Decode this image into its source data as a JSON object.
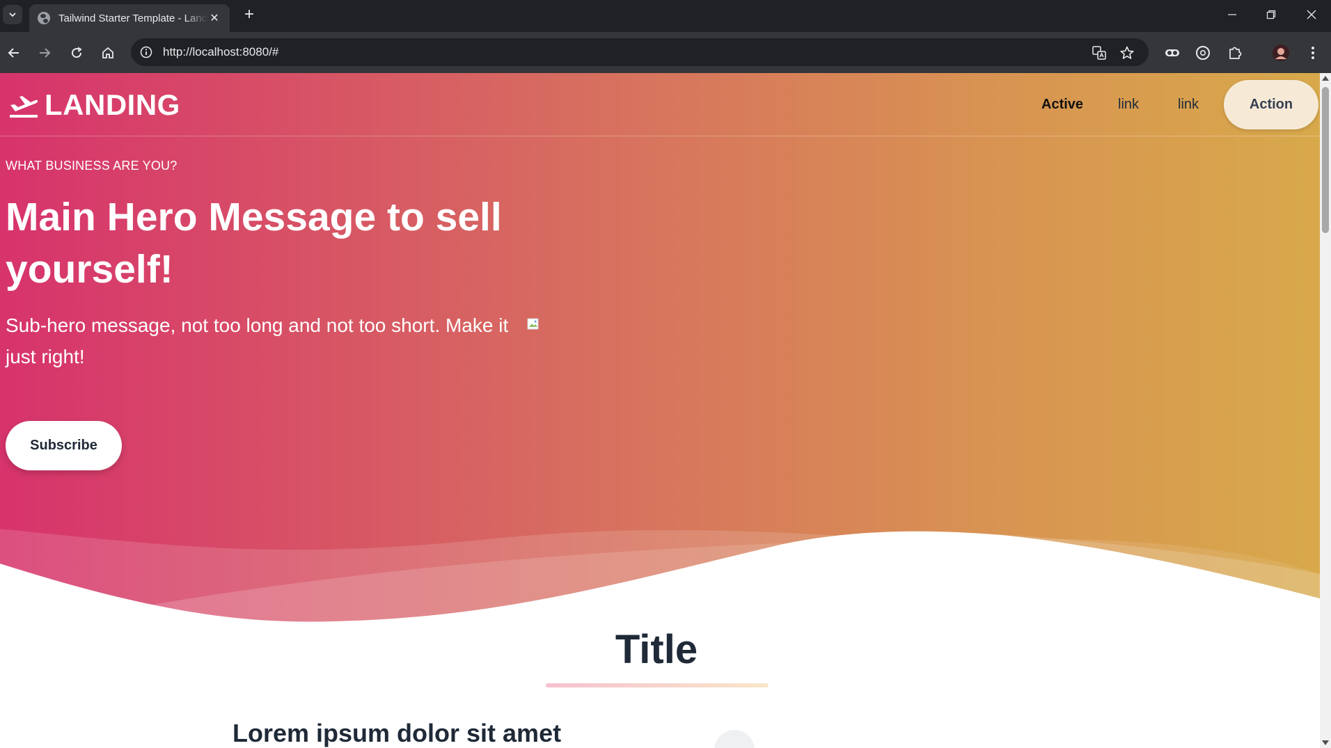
{
  "browser": {
    "tab_title": "Tailwind Starter Template - Landing",
    "tab_close": "✕",
    "new_tab": "+",
    "url": "http://localhost:8080/#",
    "icons": [
      "tab-search-icon",
      "globe-icon",
      "back-icon",
      "forward-icon",
      "reload-icon",
      "home-icon",
      "site-info-icon",
      "translate-icon",
      "star-icon",
      "extension-toggle-icon",
      "extension-circle-icon",
      "puzzle-icon",
      "avatar",
      "kebab-menu-icon",
      "minimize-icon",
      "restore-icon",
      "close-window-icon"
    ]
  },
  "nav": {
    "logo_text": "LANDING",
    "links": [
      "Active",
      "link",
      "link"
    ],
    "action_label": "Action"
  },
  "hero": {
    "eyebrow": "WHAT BUSINESS ARE YOU?",
    "title": "Main Hero Message to sell yourself!",
    "subtitle": "Sub-hero message, not too long and not too short. Make it just right!",
    "subscribe_label": "Subscribe"
  },
  "section": {
    "title": "Title",
    "heading": "Lorem ipsum dolor sit amet"
  },
  "colors": {
    "gradient_start": "#d7336c",
    "gradient_end": "#d8a94b",
    "action_bg": "#f6ead7",
    "text_dark": "#1f2937"
  }
}
